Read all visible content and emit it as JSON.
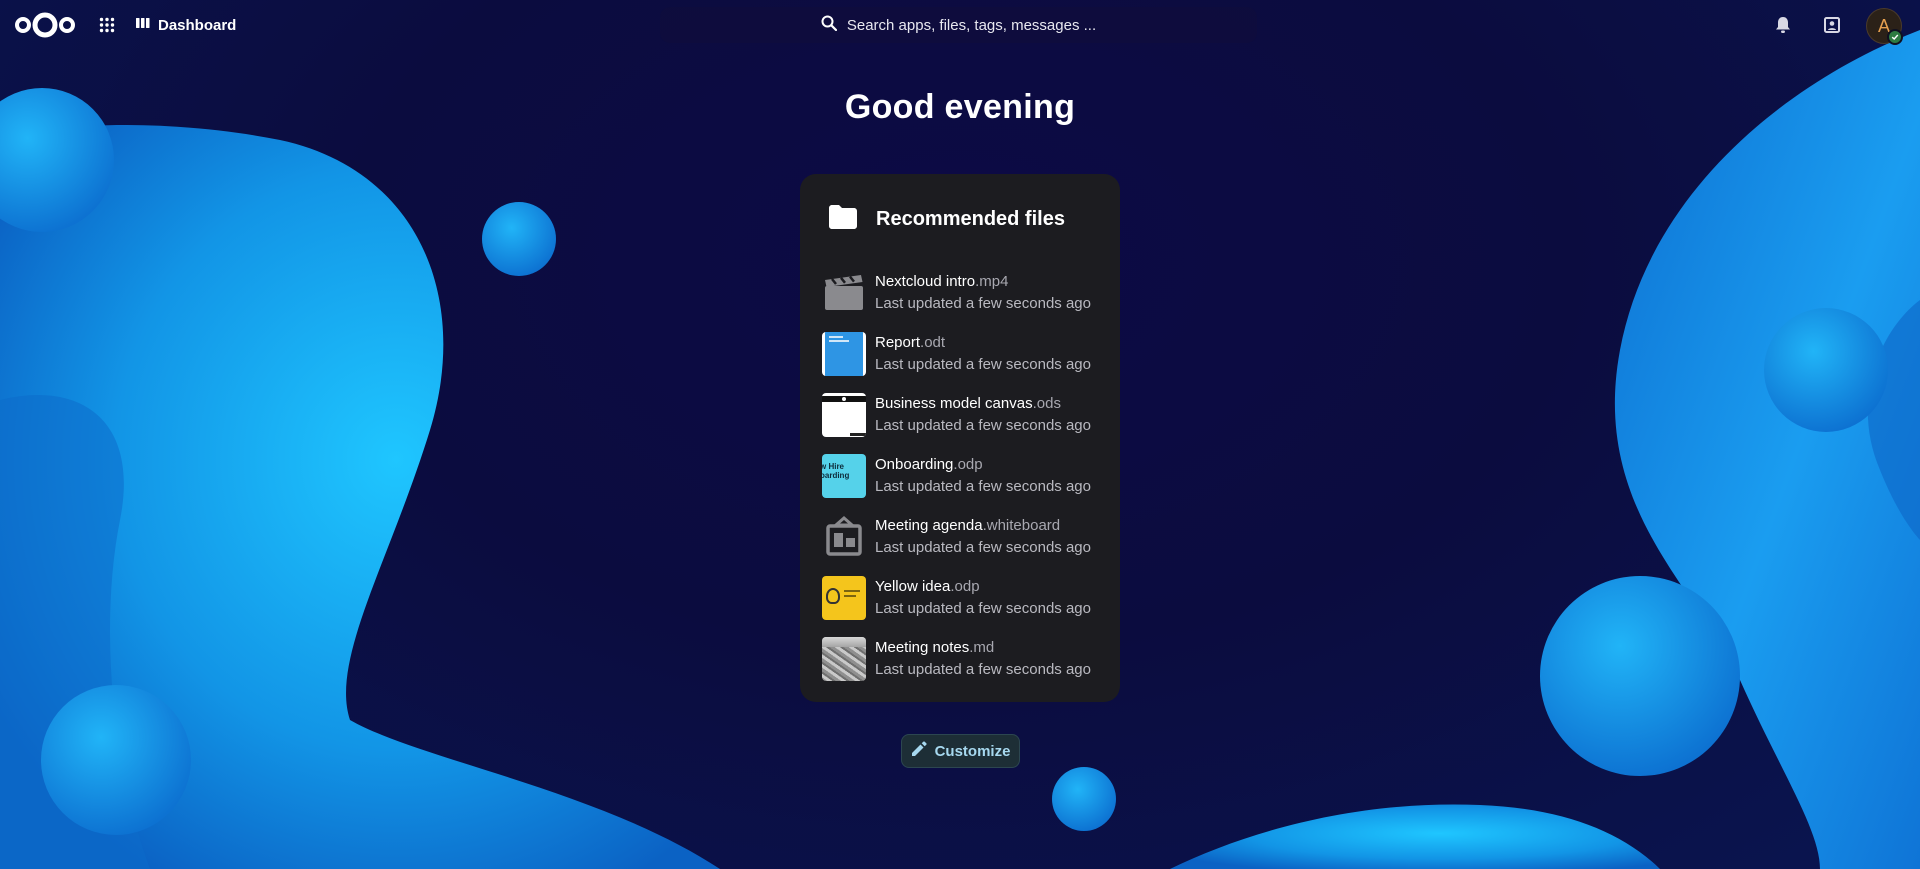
{
  "header": {
    "app_label": "Dashboard",
    "search_placeholder": "Search apps, files, tags, messages ...",
    "avatar_initial": "A"
  },
  "greeting": "Good evening",
  "widget": {
    "title": "Recommended files",
    "files": [
      {
        "name": "Nextcloud intro",
        "ext": ".mp4",
        "updated": "Last updated a few seconds ago",
        "thumb": "video-icon"
      },
      {
        "name": "Report",
        "ext": ".odt",
        "updated": "Last updated a few seconds ago",
        "thumb": "document-preview"
      },
      {
        "name": "Business model canvas",
        "ext": ".ods",
        "updated": "Last updated a few seconds ago",
        "thumb": "spreadsheet-preview"
      },
      {
        "name": "Onboarding",
        "ext": ".odp",
        "updated": "Last updated a few seconds ago",
        "thumb": "presentation-preview",
        "thumb_text": "w Hire\noarding"
      },
      {
        "name": "Meeting agenda",
        "ext": ".whiteboard",
        "updated": "Last updated a few seconds ago",
        "thumb": "whiteboard-icon"
      },
      {
        "name": "Yellow idea",
        "ext": ".odp",
        "updated": "Last updated a few seconds ago",
        "thumb": "yellow-presentation-preview"
      },
      {
        "name": "Meeting notes",
        "ext": ".md",
        "updated": "Last updated a few seconds ago",
        "thumb": "photo-preview"
      }
    ]
  },
  "customize_label": "Customize",
  "colors": {
    "background": "#0c0a3a",
    "blob": "#1aa3f0",
    "panel": "#1c1c20",
    "accent": "#a6d8ef"
  }
}
